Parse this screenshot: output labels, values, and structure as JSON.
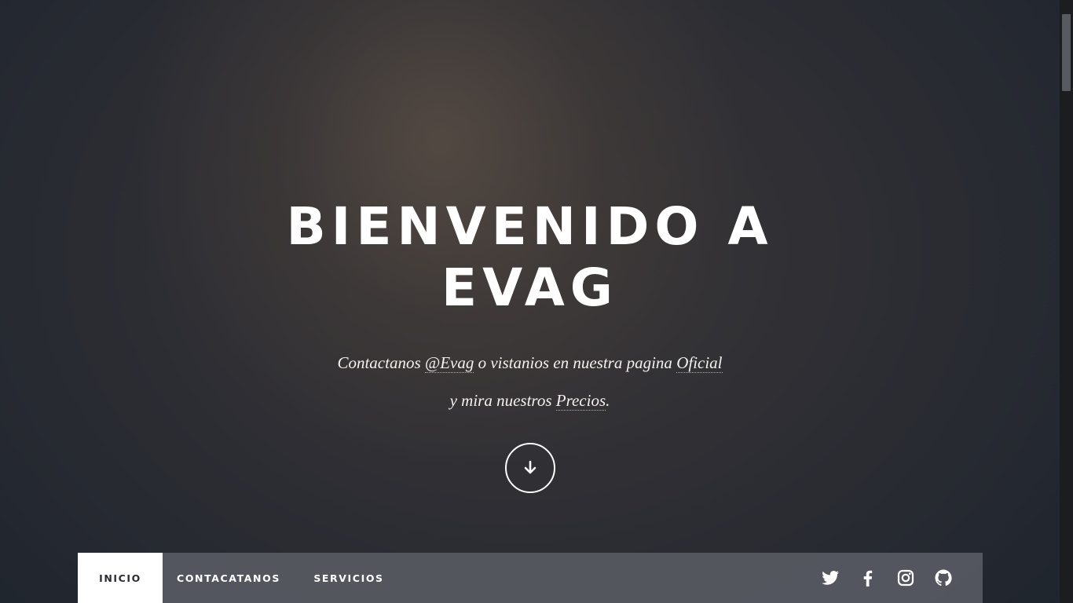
{
  "hero": {
    "title": "BIENVENIDO A EVAG",
    "line1": {
      "before": "Contactanos ",
      "handle_link": "@Evag",
      "middle": " o vistanios en nuestra pagina ",
      "official_link": "Oficial"
    },
    "line2": {
      "before": "y mira nuestros ",
      "prices_link": "Precios",
      "after": "."
    },
    "scroll_button_icon": "arrow-down-icon"
  },
  "nav": {
    "items": [
      {
        "label": "INICIO",
        "active": true
      },
      {
        "label": "CONTACATANOS",
        "active": false
      },
      {
        "label": "SERVICIOS",
        "active": false
      }
    ],
    "social_icons": [
      "twitter-icon",
      "facebook-icon",
      "instagram-icon",
      "github-icon"
    ]
  },
  "colors": {
    "background_dark": "#1f2229",
    "nav_background": "#5c5e66",
    "active_tab_background": "#ffffff",
    "text": "#ffffff"
  }
}
